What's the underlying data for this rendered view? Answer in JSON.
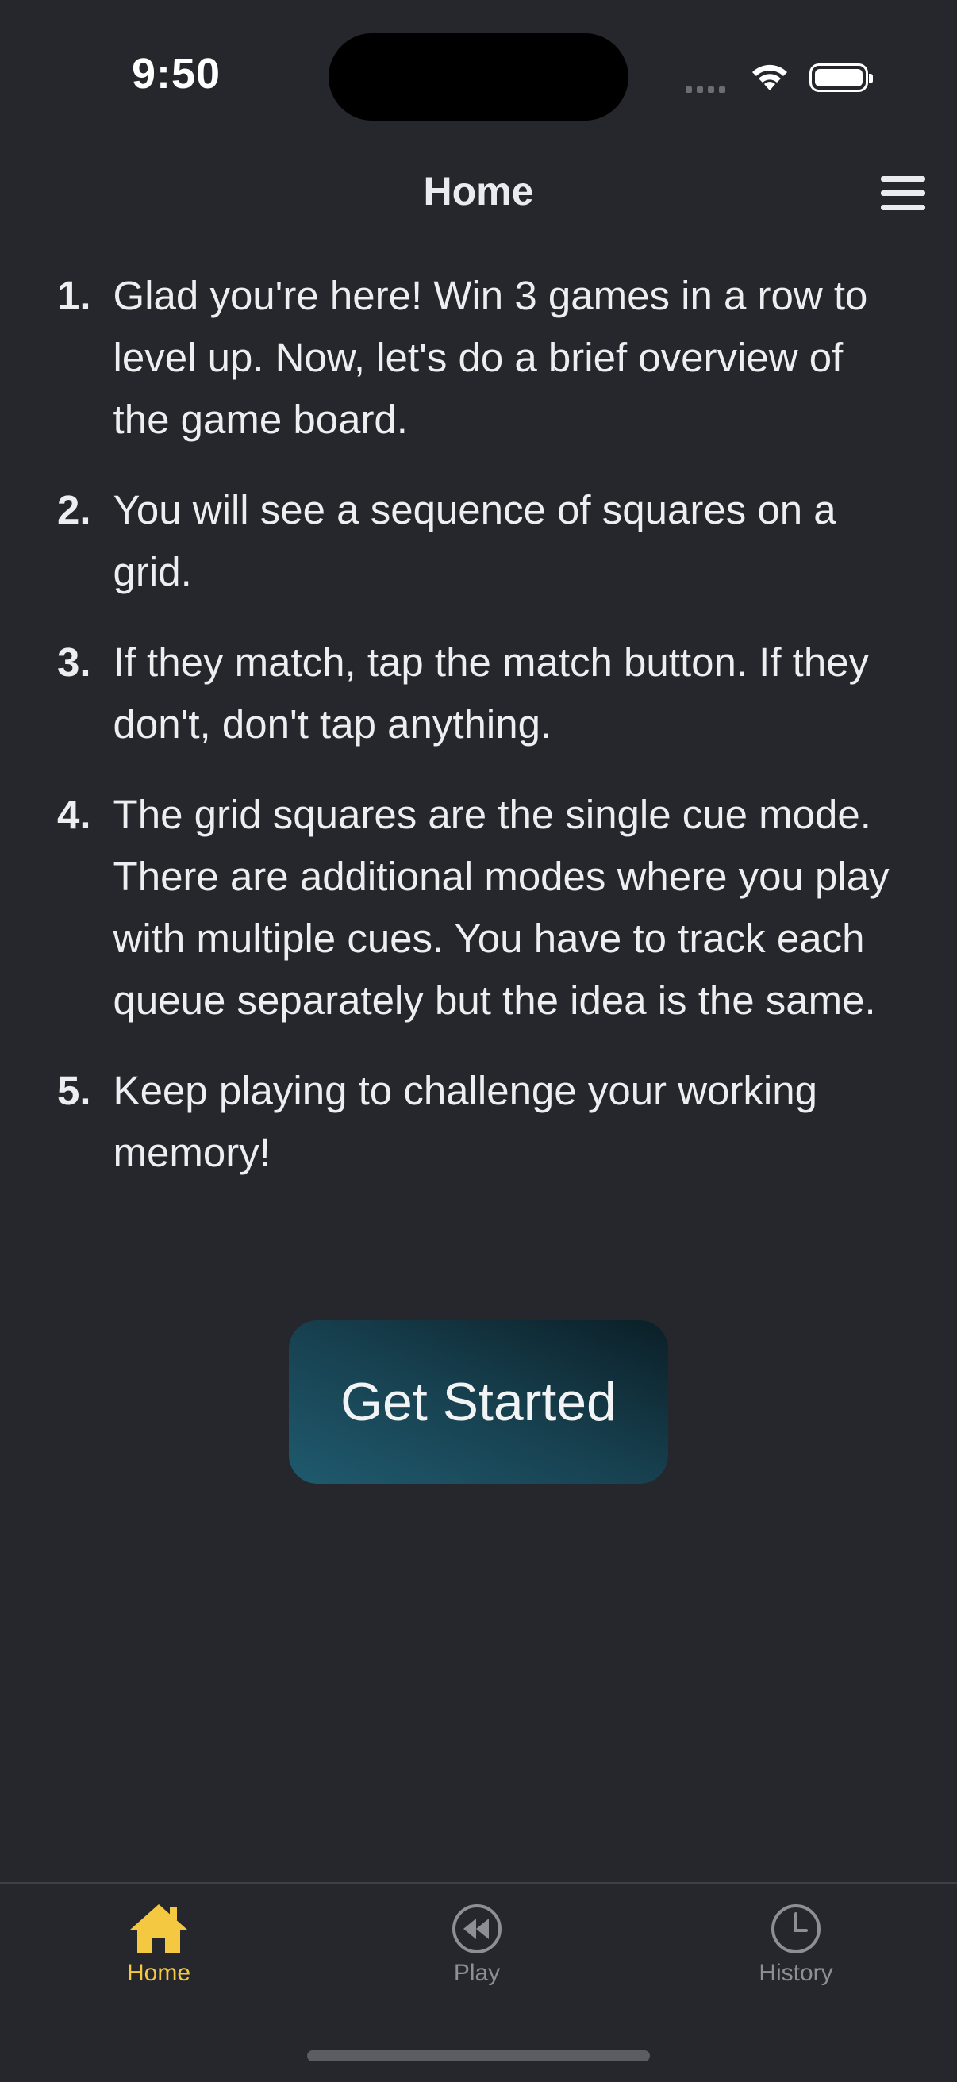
{
  "status_bar": {
    "time": "9:50"
  },
  "nav": {
    "title": "Home"
  },
  "steps": [
    {
      "num": "1.",
      "text": "Glad you're here! Win 3 games in a row to level up. Now, let's do a brief overview of the game board."
    },
    {
      "num": "2.",
      "text": "You will see a sequence of squares on a grid."
    },
    {
      "num": "3.",
      "text": "If they match, tap the match button. If they don't, don't tap anything."
    },
    {
      "num": "4.",
      "text": "The grid squares are the single cue mode. There are additional modes where you play with multiple cues. You have to track each queue separately but the idea is the same."
    },
    {
      "num": "5.",
      "text": "Keep playing to challenge your working memory!"
    }
  ],
  "cta": {
    "label": "Get Started"
  },
  "tabbar": {
    "active": "Home",
    "active_color": "#f5c842",
    "inactive_color": "#8d8f94",
    "items": [
      {
        "label": "Home",
        "icon": "house-icon"
      },
      {
        "label": "Play",
        "icon": "rewind-circle-icon"
      },
      {
        "label": "History",
        "icon": "clock-icon"
      }
    ]
  },
  "colors": {
    "background": "#25272c",
    "text": "#eceef0"
  }
}
